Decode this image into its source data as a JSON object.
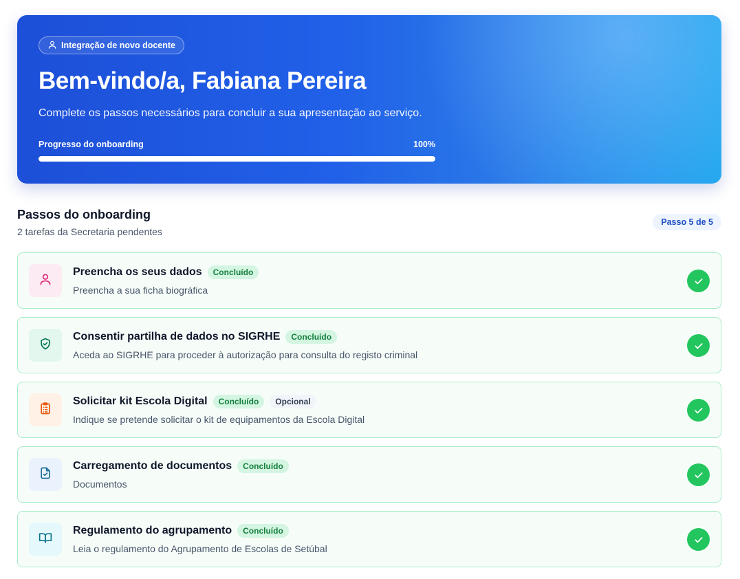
{
  "hero": {
    "pill_label": "Integração de novo docente",
    "title": "Bem-vindo/a, Fabiana Pereira",
    "subtitle": "Complete os passos necessários para concluir a sua apresentação ao serviço.",
    "progress_label": "Progresso do onboarding",
    "progress_value": "100%",
    "progress_fraction": 1.0
  },
  "section": {
    "title": "Passos do onboarding",
    "subtitle": "2 tarefas da Secretaria pendentes",
    "step_badge": "Passo 5 de 5"
  },
  "steps": [
    {
      "title": "Preencha os seus dados",
      "status": "Concluído",
      "description": "Preencha a sua ficha biográfica",
      "icon": "user-icon",
      "icon_color": "#db2777",
      "icon_bg": "#fdebf3"
    },
    {
      "title": "Consentir partilha de dados no SIGRHE",
      "status": "Concluído",
      "description": "Aceda ao SIGRHE para proceder à autorização para consulta do registo criminal",
      "icon": "shield-check-icon",
      "icon_color": "#047857",
      "icon_bg": "#e3f7ee"
    },
    {
      "title": "Solicitar kit Escola Digital",
      "status": "Concluído",
      "optional": "Opcional",
      "description": "Indique se pretende solicitar o kit de equipamentos da Escola Digital",
      "icon": "clipboard-list-icon",
      "icon_color": "#ea580c",
      "icon_bg": "#fff1e6"
    },
    {
      "title": "Carregamento de documentos",
      "status": "Concluído",
      "description": "Documentos",
      "icon": "file-check-icon",
      "icon_color": "#1f6f9a",
      "icon_bg": "#eaf3fd"
    },
    {
      "title": "Regulamento do agrupamento",
      "status": "Concluído",
      "description": "Leia o regulamento do Agrupamento de Escolas de Setúbal",
      "icon": "book-open-icon",
      "icon_color": "#0e7490",
      "icon_bg": "#e5f8fb"
    }
  ],
  "colors": {
    "accent": "#2563eb",
    "success": "#22c55e",
    "card_border": "#a7ebc6"
  }
}
